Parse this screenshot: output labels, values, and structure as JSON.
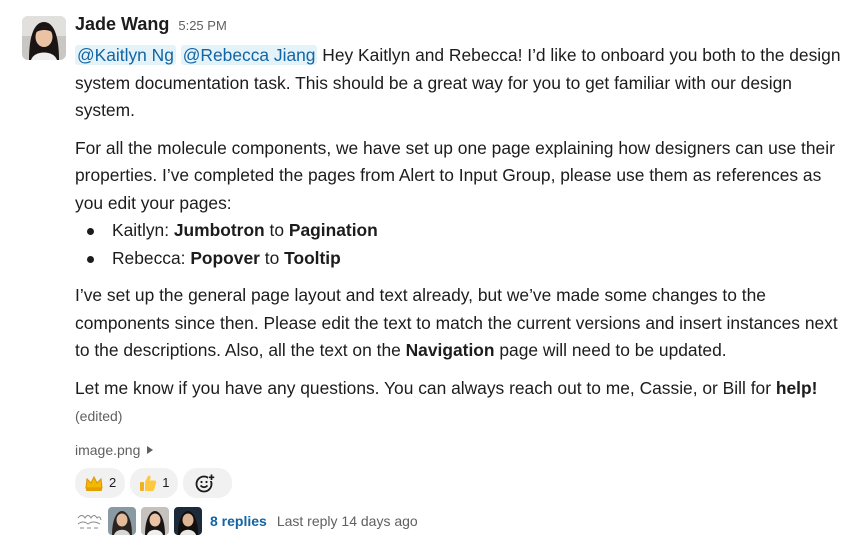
{
  "message": {
    "author": "Jade Wang",
    "time": "5:25 PM",
    "mentions": [
      "@Kaitlyn Ng",
      "@Rebecca Jiang"
    ],
    "intro_text": " Hey Kaitlyn and Rebecca! I’d like to onboard you both to the design system documentation task. This should be a great way for you to get familiar with our design system.",
    "para2": "For all the molecule components, we have set up one page explaining how designers can use their properties. I’ve completed the pages from Alert to Input Group, please use them as references as you edit your pages:",
    "bullets": [
      {
        "name": "Kaitlyn:",
        "from": "Jumbotron",
        "to_word": "to",
        "to": "Pagination"
      },
      {
        "name": "Rebecca:",
        "from": "Popover",
        "to_word": "to",
        "to": "Tooltip"
      }
    ],
    "para3_before": "I’ve set up the general page layout and text already, but we’ve made some changes to the components since then. Please edit the text to match the current versions and insert instances next to the descriptions. Also, all the text on the ",
    "para3_bold": "Navigation",
    "para3_after": " page will need to be updated.",
    "para4_before": "Let me know if you have any questions. You can always reach out to me, Cassie, or Bill for ",
    "para4_bold": "help!",
    "edited": "(edited)",
    "attachment": "image.png"
  },
  "reactions": [
    {
      "icon": "crown-icon",
      "count": "2"
    },
    {
      "icon": "thumbs-up-icon",
      "count": "1"
    }
  ],
  "thread": {
    "replies": "8 replies",
    "last_reply": "Last reply 14 days ago"
  },
  "colors": {
    "mention": "#1264a3",
    "mention_bg": "#e8f5fa",
    "link": "#1264a3",
    "muted": "#616061",
    "reaction_bg": "#f1f1f1"
  }
}
